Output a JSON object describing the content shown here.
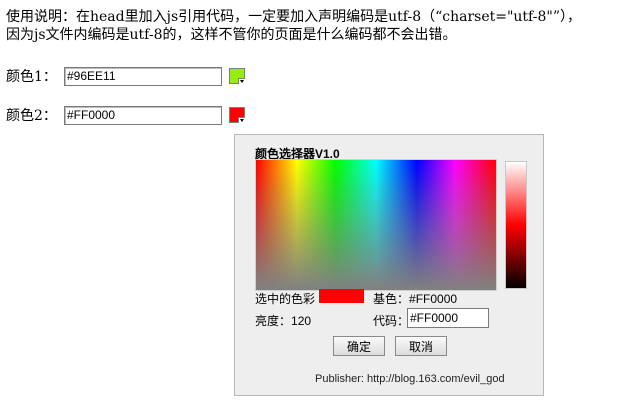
{
  "instructions": {
    "line1": "使用说明：在head里加入js引用代码，一定要加入声明编码是utf-8（“charset=\"utf-8\"”），",
    "line2": "因为js文件内编码是utf-8的，这样不管你的页面是什么编码都不会出错。"
  },
  "fields": [
    {
      "label": "颜色1：",
      "value": "#96EE11",
      "swatch_color": "#96EE11"
    },
    {
      "label": "颜色2：",
      "value": "#FF0000",
      "swatch_color": "#FF0000"
    }
  ],
  "picker": {
    "title": "颜色选择器V1.0",
    "selected_label": "选中的色彩",
    "selected_color": "#FF0000",
    "base_label": "基色：",
    "base_value": "#FF0000",
    "brightness_label": "亮度：",
    "brightness_value": "120",
    "code_label": "代码：",
    "code_value": "#FF0000",
    "ok_label": "确定",
    "cancel_label": "取消",
    "publisher": "Publisher: http://blog.163.com/evil_god"
  }
}
